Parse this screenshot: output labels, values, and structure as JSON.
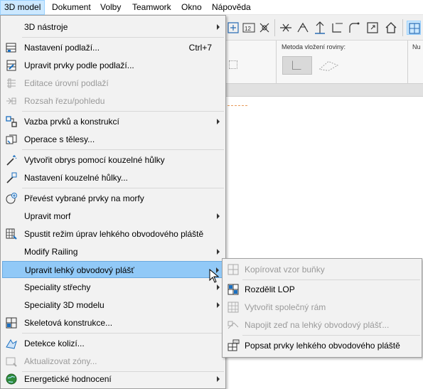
{
  "menubar": {
    "items": [
      "3D model",
      "Dokument",
      "Volby",
      "Teamwork",
      "Okno",
      "Nápověda"
    ]
  },
  "infobox": {
    "method_label": "Metoda vložení roviny:",
    "cut_label": "Nu"
  },
  "menu": {
    "items": [
      {
        "label": "3D nástroje",
        "icon": "none",
        "submenu": true
      },
      {
        "label": "Nastavení podlaží...",
        "shortcut": "Ctrl+7",
        "icon": "floor-settings-icon"
      },
      {
        "label": "Upravit prvky podle podlaží...",
        "icon": "edit-by-floor-icon"
      },
      {
        "label": "Editace úrovní podlaží",
        "icon": "floor-levels-icon",
        "disabled": true
      },
      {
        "label": "Rozsah řezu/pohledu",
        "icon": "section-range-icon",
        "disabled": true
      },
      {
        "label": "Vazba prvků a konstrukcí",
        "icon": "element-link-icon",
        "submenu": true
      },
      {
        "label": "Operace s tělesy...",
        "icon": "solid-operations-icon"
      },
      {
        "label": "Vytvořit obrys pomocí kouzelné hůlky",
        "icon": "magic-wand-icon"
      },
      {
        "label": "Nastavení kouzelné hůlky...",
        "icon": "magic-wand-settings-icon"
      },
      {
        "label": "Převést vybrané prvky na morfy",
        "icon": "convert-morph-icon"
      },
      {
        "label": "Upravit morf",
        "icon": "none",
        "submenu": true
      },
      {
        "label": "Spustit režim úprav lehkého obvodového pláště",
        "icon": "curtain-wall-edit-icon"
      },
      {
        "label": "Modify Railing",
        "icon": "none",
        "submenu": true
      },
      {
        "label": "Upravit lehký obvodový plášť",
        "icon": "none",
        "submenu": true,
        "highlighted": true
      },
      {
        "label": "Speciality střechy",
        "icon": "none",
        "submenu": true
      },
      {
        "label": "Speciality 3D modelu",
        "icon": "none",
        "submenu": true
      },
      {
        "label": "Skeletová konstrukce...",
        "icon": "skeleton-icon"
      },
      {
        "label": "Detekce kolizí...",
        "icon": "collision-detection-icon"
      },
      {
        "label": "Aktualizovat zóny...",
        "icon": "update-zones-icon",
        "disabled": true
      },
      {
        "label": "Energetické hodnocení",
        "icon": "energy-globe-icon",
        "submenu": true
      }
    ]
  },
  "submenu": {
    "items": [
      {
        "label": "Kopírovat vzor buňky",
        "icon": "copy-cell-pattern-icon",
        "disabled": true
      },
      {
        "label": "Rozdělit LOP",
        "icon": "split-curtain-wall-icon"
      },
      {
        "label": "Vytvořit společný rám",
        "icon": "common-frame-icon",
        "disabled": true
      },
      {
        "label": "Napojit zeď na lehký obvodový plášť...",
        "icon": "connect-wall-icon",
        "disabled": true
      },
      {
        "label": "Popsat prvky lehkého obvodového pláště",
        "icon": "label-elements-icon"
      }
    ]
  },
  "colors": {
    "menu_bg": "#f2f2f2",
    "highlight": "#91c9f7",
    "menubar_active": "#cce8ff",
    "disabled_text": "#9a9a9a",
    "icon_blue": "#1a6fc0"
  }
}
